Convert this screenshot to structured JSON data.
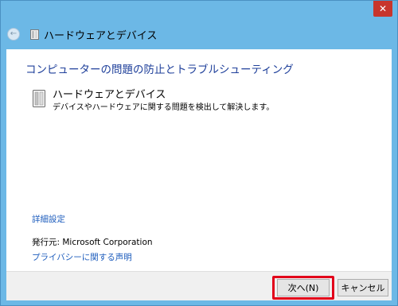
{
  "window": {
    "close_glyph": "✕",
    "back_glyph": "←",
    "nav_title": "ハードウェアとデバイス"
  },
  "content": {
    "heading": "コンピューターの問題の防止とトラブルシューティング",
    "item": {
      "title": "ハードウェアとデバイス",
      "description": "デバイスやハードウェアに関する問題を検出して解決します。",
      "icon": "hardware-device-icon"
    },
    "advanced_link": "詳細設定",
    "publisher": "発行元:  Microsoft Corporation",
    "privacy_link": "プライバシーに関する声明"
  },
  "footer": {
    "next_label": "次へ(N)",
    "cancel_label": "キャンセル"
  },
  "colors": {
    "accent_link": "#1e5dbd",
    "heading": "#1e3f9a",
    "window_frame": "#6cb8e6",
    "close_button": "#c7352c",
    "highlight": "#e2001a"
  }
}
